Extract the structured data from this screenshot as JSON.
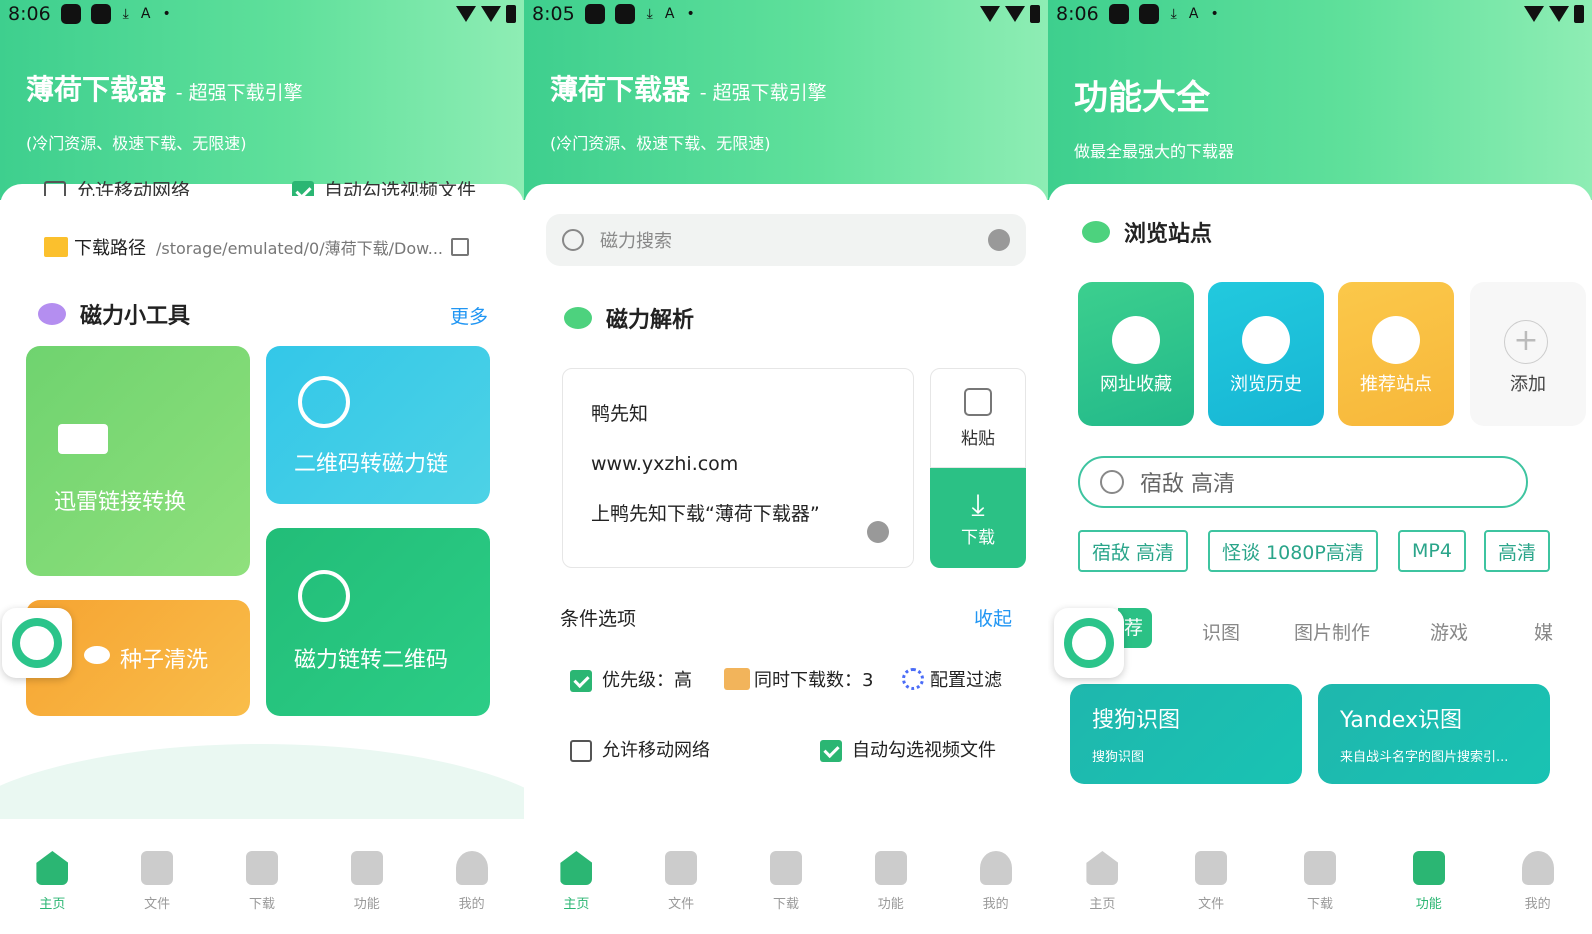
{
  "status": {
    "time1": "8:06",
    "time2": "8:05",
    "time3": "8:06",
    "sim": "A"
  },
  "app": {
    "title": "薄荷下载器",
    "subtitle": "- 超强下载引擎",
    "desc": "(冷门资源、极速下载、无限速)"
  },
  "p1": {
    "partial_left": "允许移动网络",
    "partial_right": "自动勾选视频文件",
    "path_label": "下载路径",
    "path_value": "/storage/emulated/0/薄荷下载/Dow...",
    "tools_title": "磁力小工具",
    "more": "更多",
    "tiles": [
      "迅雷链接转换",
      "二维码转磁力链",
      "种子清洗",
      "磁力链转二维码"
    ]
  },
  "p2": {
    "search_placeholder": "磁力搜索",
    "section": "磁力解析",
    "lines": [
      "鸭先知",
      "www.yxzhi.com",
      "上鸭先知下载“薄荷下载器”"
    ],
    "paste": "粘贴",
    "download": "下载",
    "cond": "条件选项",
    "collapse": "收起",
    "priority": "优先级：高",
    "concurrent": "同时下载数：3",
    "filter": "配置过滤",
    "allow_mobile": "允许移动网络",
    "auto_video": "自动勾选视频文件"
  },
  "p3": {
    "title": "功能大全",
    "desc": "做最全最强大的下载器",
    "section": "浏览站点",
    "sites": [
      "网址收藏",
      "浏览历史",
      "推荐站点",
      "添加"
    ],
    "search": "宿敌 高清",
    "tags": [
      "宿敌 高清",
      "怪谈 1080P高清",
      "MP4",
      "高清"
    ],
    "cats": [
      "荐",
      "识图",
      "图片制作",
      "游戏",
      "媒"
    ],
    "cards": [
      {
        "title": "搜狗识图",
        "sub": "搜狗识图"
      },
      {
        "title": "Yandex识图",
        "sub": "来自战斗名字的图片搜索引..."
      }
    ]
  },
  "nav": [
    "主页",
    "文件",
    "下载",
    "功能",
    "我的"
  ],
  "colors": {
    "accent": "#2bb673",
    "header": "#4fd893",
    "blue": "#2196f3",
    "orange": "#f7b23b",
    "teal": "#19b8b0"
  }
}
